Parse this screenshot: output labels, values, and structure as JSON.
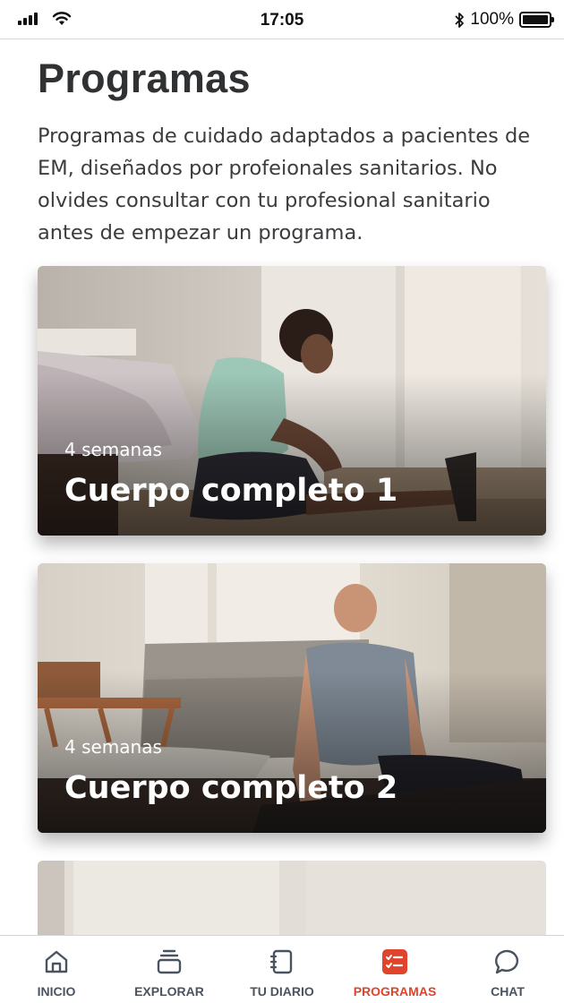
{
  "status_bar": {
    "time": "17:05",
    "battery_percent": "100%",
    "bluetooth_icon": "bluetooth-icon",
    "wifi_icon": "wifi-icon",
    "signal_icon": "signal-icon"
  },
  "header": {
    "title": "Programas",
    "intro": "Programas de cuidado adaptados a pacientes de EM, diseñados por profeionales sanitarios. No olvides consultar con tu profesional sanitario antes de empezar un programa."
  },
  "programs": [
    {
      "duration": "4 semanas",
      "title": "Cuerpo completo 1"
    },
    {
      "duration": "4 semanas",
      "title": "Cuerpo completo 2"
    }
  ],
  "tab_bar": {
    "tabs": [
      {
        "label": "INICIO",
        "icon": "home-icon"
      },
      {
        "label": "EXPLORAR",
        "icon": "layers-icon"
      },
      {
        "label": "TU DIARIO",
        "icon": "notebook-icon"
      },
      {
        "label": "PROGRAMAS",
        "icon": "checklist-icon",
        "active": true
      },
      {
        "label": "CHAT",
        "icon": "chat-bubble-icon"
      }
    ],
    "active_color": "#e0442c",
    "inactive_color": "#4a5360"
  }
}
